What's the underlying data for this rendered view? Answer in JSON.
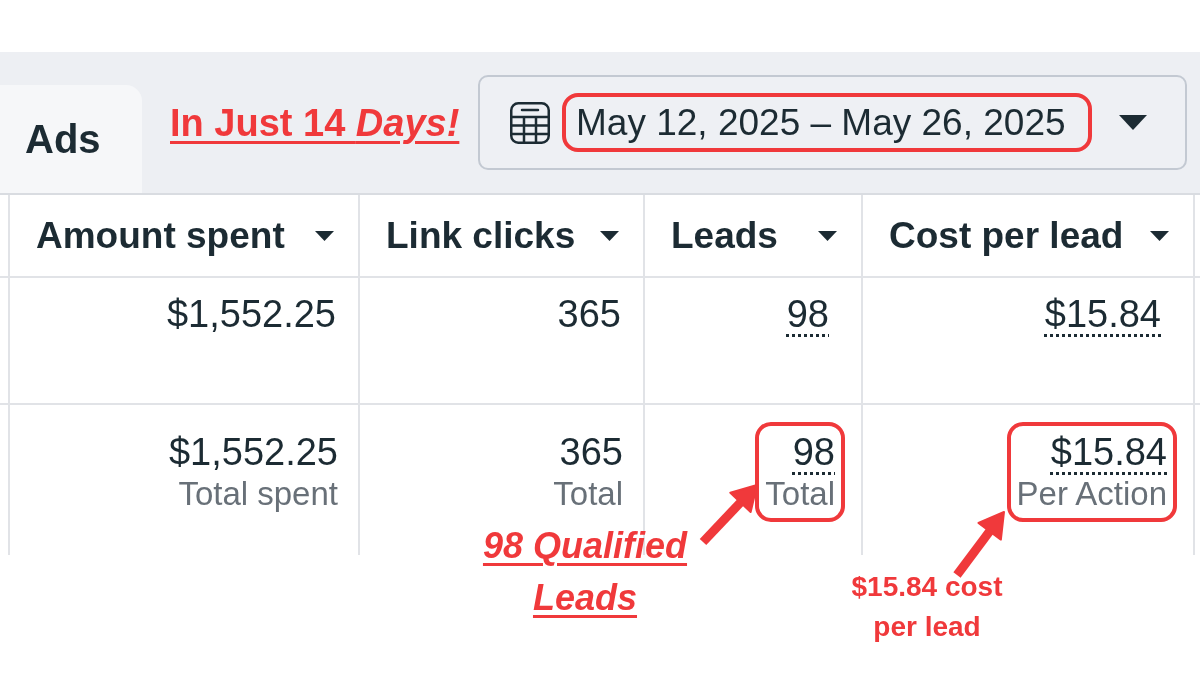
{
  "tabs": [
    {
      "label": "Ads",
      "selected": true
    }
  ],
  "headline": "In Just 14 *Days!*",
  "date_picker": {
    "value": "May 12, 2025 – May 26, 2025",
    "highlighted": true
  },
  "table": {
    "columns": [
      {
        "label": "Amount spent"
      },
      {
        "label": "Link clicks"
      },
      {
        "label": "Leads"
      },
      {
        "label": "Cost per lead"
      }
    ],
    "rows": [
      {
        "cells": [
          {
            "kind": "plain",
            "value": "$1,552.25"
          },
          {
            "kind": "plain",
            "value": "365"
          },
          {
            "kind": "link",
            "value": "98"
          },
          {
            "kind": "link",
            "value": "$15.84"
          }
        ]
      }
    ],
    "totals": [
      {
        "kind": "plain",
        "value": "$1,552.25",
        "caption": "Total spent",
        "highlighted": false
      },
      {
        "kind": "plain",
        "value": "365",
        "caption": "Total",
        "highlighted": false
      },
      {
        "kind": "link",
        "value": "98",
        "caption": "Total",
        "highlighted": true
      },
      {
        "kind": "link",
        "value": "$15.84",
        "caption": "Per Action",
        "highlighted": true
      }
    ]
  },
  "annotations": [
    {
      "kind": "callout",
      "text": "98 Qualified Leads"
    },
    {
      "kind": "note",
      "text": "$15.84 cost per lead"
    }
  ]
}
